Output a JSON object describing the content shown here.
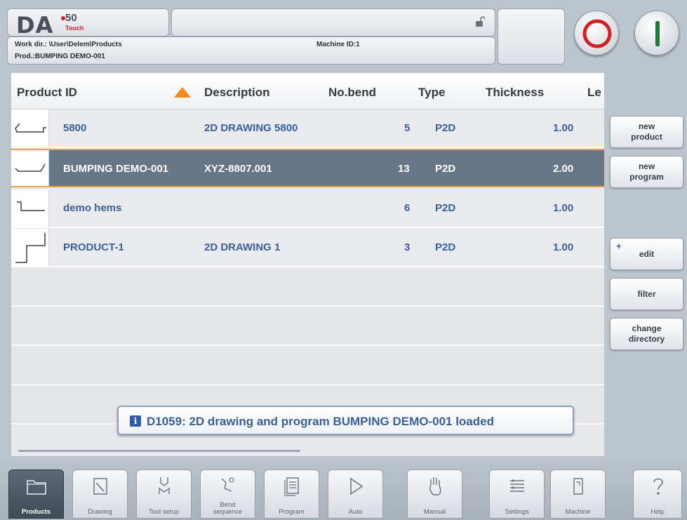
{
  "header": {
    "logo": {
      "brand": "DA",
      "number": "50",
      "sub": "Touch"
    },
    "work_dir": "Work dir.: \\User\\Delem\\Products",
    "prod": "Prod.:BUMPING DEMO-001",
    "machine_id": "Machine ID:1"
  },
  "table": {
    "columns": [
      "Product ID",
      "Description",
      "No.bend",
      "Type",
      "Thickness",
      "Le"
    ],
    "sort": {
      "column": "Product ID",
      "direction": "ascending",
      "indicator_color": "#f08a1c"
    },
    "rows": [
      {
        "product_id": "5800",
        "description": "2D DRAWING 5800",
        "no_bend": "5",
        "type": "P2D",
        "thickness": "1.00",
        "selected": false
      },
      {
        "product_id": "BUMPING DEMO-001",
        "description": "XYZ-8807.001",
        "no_bend": "13",
        "type": "P2D",
        "thickness": "2.00",
        "selected": true
      },
      {
        "product_id": "demo hems",
        "description": "",
        "no_bend": "6",
        "type": "P2D",
        "thickness": "1.00",
        "selected": false
      },
      {
        "product_id": "PRODUCT-1",
        "description": "2D DRAWING 1",
        "no_bend": "3",
        "type": "P2D",
        "thickness": "1.00",
        "selected": false
      }
    ]
  },
  "message": {
    "icon": "info-icon",
    "icon_glyph": "i",
    "text": "D1059: 2D drawing and program BUMPING DEMO-001 loaded"
  },
  "side_buttons": {
    "new_product": "new\nproduct",
    "new_program": "new\nprogram",
    "edit": "edit",
    "edit_plus": "+",
    "filter": "filter",
    "change_directory": "change\ndirectory"
  },
  "nav": {
    "products": "Products",
    "drawing": "Drawing",
    "tool_setup": "Tool setup",
    "bend_sequence": "Bend\nsequence",
    "program": "Program",
    "auto": "Auto",
    "manual": "Manual",
    "settings": "Settings",
    "machine": "Machine",
    "help": "Help"
  },
  "colors": {
    "accent": "#3c5f97",
    "selected_row": "#677686",
    "stop": "#d31f26",
    "start": "#1f7a3a"
  }
}
